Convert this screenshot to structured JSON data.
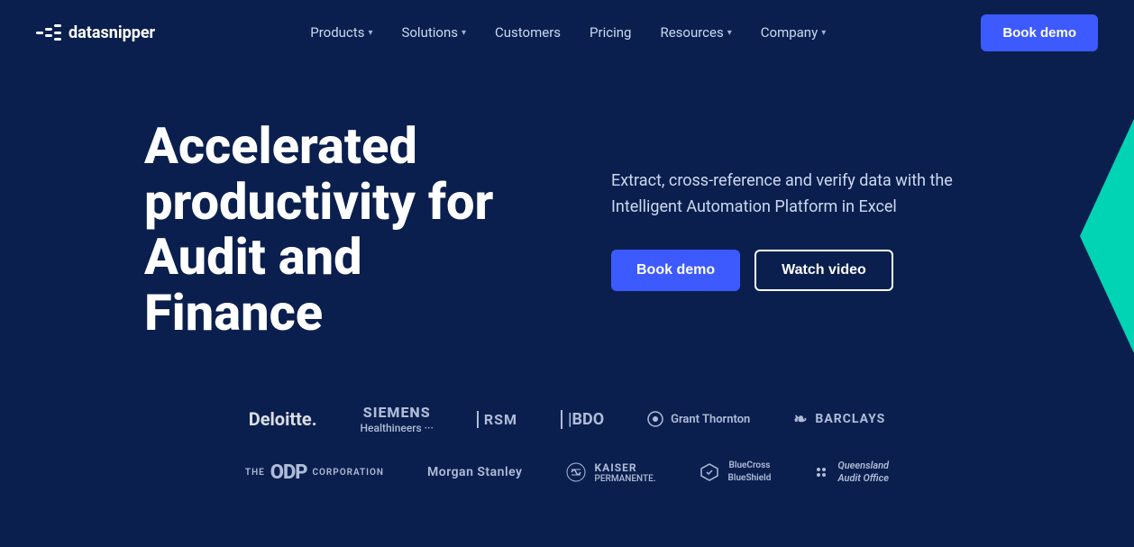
{
  "brand": {
    "name": "datasnipper",
    "logo_alt": "DataSnipper logo"
  },
  "nav": {
    "links": [
      {
        "label": "Products",
        "has_dropdown": true
      },
      {
        "label": "Solutions",
        "has_dropdown": true
      },
      {
        "label": "Customers",
        "has_dropdown": false
      },
      {
        "label": "Pricing",
        "has_dropdown": false
      },
      {
        "label": "Resources",
        "has_dropdown": true
      },
      {
        "label": "Company",
        "has_dropdown": true
      }
    ],
    "cta_label": "Book demo"
  },
  "hero": {
    "title": "Accelerated productivity for Audit and Finance",
    "subtitle": "Extract, cross-reference and verify data with the Intelligent Automation Platform in Excel",
    "btn_primary": "Book demo",
    "btn_secondary": "Watch video"
  },
  "logos": {
    "row1": [
      {
        "name": "Deloitte.",
        "style": "deloitte"
      },
      {
        "name": "SIEMENS Healthineers",
        "style": "siemens"
      },
      {
        "name": "| RSM",
        "style": "rsm"
      },
      {
        "name": "|BDO",
        "style": "bdo"
      },
      {
        "name": "⊙ Grant Thornton",
        "style": "gt"
      },
      {
        "name": "❧ BARCLAYS",
        "style": "barclays"
      }
    ],
    "row2": [
      {
        "name": "THE ODP CORPORATION",
        "style": "odp"
      },
      {
        "name": "Morgan Stanley",
        "style": "morgan"
      },
      {
        "name": "✿ KAISER PERMANENTE.",
        "style": "kaiser"
      },
      {
        "name": "BlueCross BlueShield",
        "style": "bcbs"
      },
      {
        "name": "Queensland Audit Office",
        "style": "qao"
      }
    ]
  }
}
